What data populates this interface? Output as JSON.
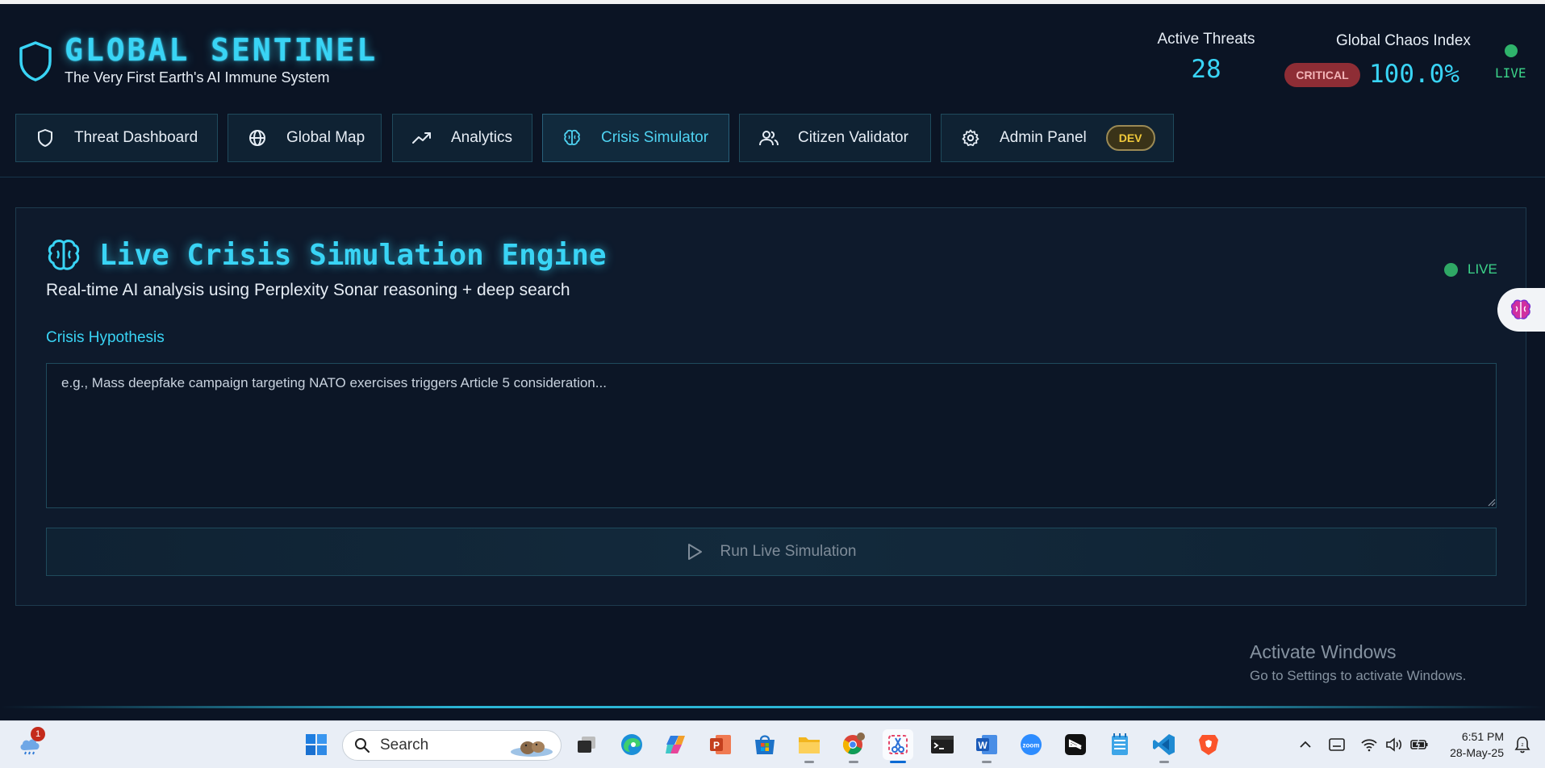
{
  "brand": {
    "title": "GLOBAL SENTINEL",
    "subtitle": "The Very First Earth's AI Immune System"
  },
  "stats": {
    "active_threats_label": "Active Threats",
    "active_threats_value": "28",
    "chaos_label": "Global Chaos Index",
    "chaos_badge": "CRITICAL",
    "chaos_value": "100.0%",
    "live_label": "LIVE"
  },
  "nav": {
    "tabs": [
      {
        "label": "Threat Dashboard",
        "icon": "shield-icon"
      },
      {
        "label": "Global Map",
        "icon": "globe-icon"
      },
      {
        "label": "Analytics",
        "icon": "trending-up-icon"
      },
      {
        "label": "Crisis Simulator",
        "icon": "brain-icon",
        "active": true
      },
      {
        "label": "Citizen Validator",
        "icon": "users-icon"
      },
      {
        "label": "Admin Panel",
        "icon": "gear-icon",
        "badge": "DEV"
      }
    ]
  },
  "panel": {
    "title": "Live Crisis Simulation Engine",
    "subtitle": "Real-time AI analysis using Perplexity Sonar reasoning + deep search",
    "live_label": "LIVE",
    "field_label": "Crisis Hypothesis",
    "placeholder": "e.g., Mass deepfake campaign targeting NATO exercises triggers Article 5 consideration...",
    "value": "",
    "run_label": "Run Live Simulation"
  },
  "watermark": {
    "line1": "Activate Windows",
    "line2": "Go to Settings to activate Windows."
  },
  "taskbar": {
    "search_placeholder": "Search",
    "notification_count": "1",
    "time": "6:51 PM",
    "date": "28-May-25",
    "apps": [
      "start-icon",
      "search",
      "task-view-icon",
      "edge-icon",
      "copilot-icon",
      "powerpoint-icon",
      "store-icon",
      "file-explorer-icon",
      "chrome-icon",
      "snipping-tool-icon",
      "terminal-icon",
      "word-icon",
      "zoom-icon",
      "capcut-icon",
      "notepad-icon",
      "vscode-icon",
      "brave-icon"
    ]
  },
  "colors": {
    "accent": "#39d4f5",
    "background": "#0b1424",
    "critical": "#8e2d35",
    "live": "#3cd58a",
    "dev_badge": "#f0c93a"
  }
}
